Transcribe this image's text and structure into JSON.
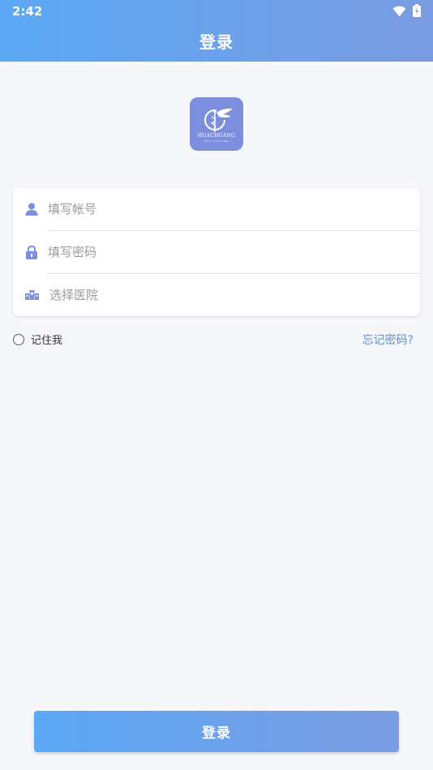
{
  "status_bar": {
    "time": "2:42",
    "icons": [
      "wifi-icon",
      "battery-charging-icon"
    ]
  },
  "header": {
    "title": "登录"
  },
  "logo": {
    "name": "HUACHUANG",
    "subtitle": "HUA CHUANG"
  },
  "form": {
    "account_placeholder": "填写帐号",
    "password_placeholder": "填写密码",
    "hospital_placeholder": "选择医院",
    "icons": [
      "user-icon",
      "lock-icon",
      "hospital-icon"
    ]
  },
  "options": {
    "remember_label": "记住我",
    "remember_checked": false,
    "forgot_label": "忘记密码?"
  },
  "footer": {
    "login_label": "登录"
  },
  "colors": {
    "accent_start": "#5ba8f5",
    "accent_end": "#7a9ce2",
    "icon": "#7b8fde",
    "link": "#5b8fd8",
    "background": "#f5f7fb"
  }
}
